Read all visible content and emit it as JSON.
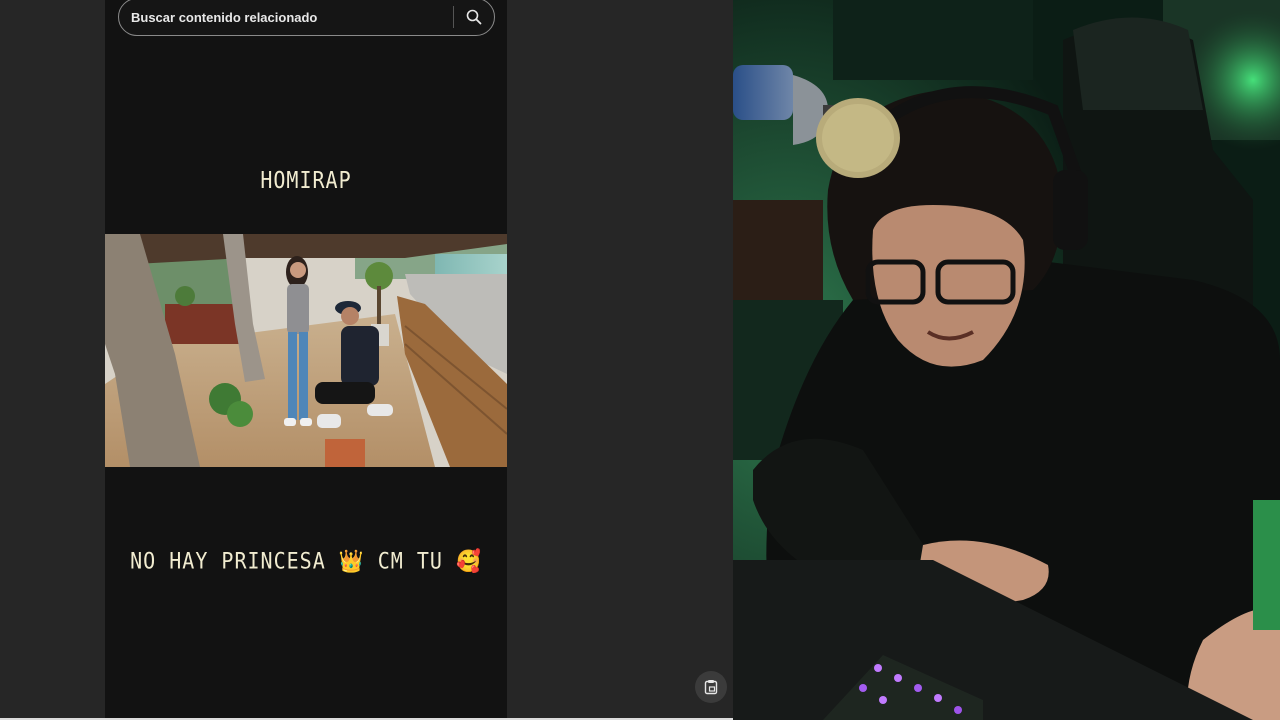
{
  "search": {
    "placeholder": "Buscar contenido relacionado",
    "icon": "search-icon"
  },
  "video": {
    "top_caption": "HOMIRAP",
    "bottom_caption": "NO HAY PRINCESA 👑 CM TU 🥰"
  },
  "corner_button": {
    "icon": "clipboard-icon"
  },
  "colors": {
    "panel_bg": "#121212",
    "page_bg": "#262626",
    "caption_text": "#f1ecd0",
    "search_border": "#8a8a8a",
    "ambient_green": "#3ddc84",
    "keyboard_glow": "#b06cff"
  }
}
